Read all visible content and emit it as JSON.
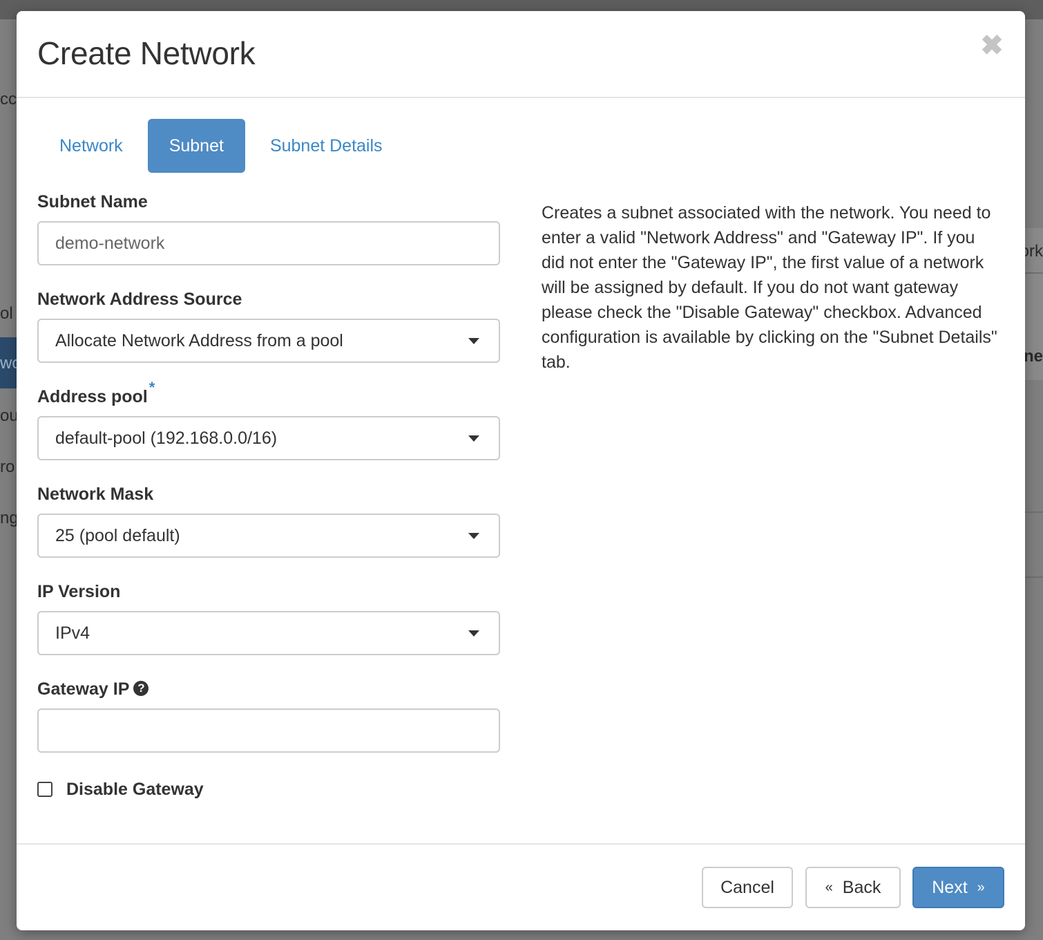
{
  "background": {
    "fragments": [
      "cc",
      "ol",
      "wo",
      "ou",
      "ro",
      "ng",
      "ork",
      "one"
    ]
  },
  "modal": {
    "title": "Create Network",
    "close_icon": "close-icon"
  },
  "tabs": [
    {
      "label": "Network",
      "active": false
    },
    {
      "label": "Subnet",
      "active": true
    },
    {
      "label": "Subnet Details",
      "active": false
    }
  ],
  "form": {
    "subnet_name": {
      "label": "Subnet Name",
      "value": "demo-network"
    },
    "network_address_source": {
      "label": "Network Address Source",
      "selected": "Allocate Network Address from a pool"
    },
    "address_pool": {
      "label": "Address pool",
      "required_marker": "*",
      "selected": "default-pool (192.168.0.0/16)"
    },
    "network_mask": {
      "label": "Network Mask",
      "selected": "25 (pool default)"
    },
    "ip_version": {
      "label": "IP Version",
      "selected": "IPv4"
    },
    "gateway_ip": {
      "label": "Gateway IP",
      "help_icon": "question-circle-icon",
      "value": ""
    },
    "disable_gateway": {
      "label": "Disable Gateway",
      "checked": false
    }
  },
  "description": "Creates a subnet associated with the network. You need to enter a valid \"Network Address\" and \"Gateway IP\". If you did not enter the \"Gateway IP\", the first value of a network will be assigned by default. If you do not want gateway please check the \"Disable Gateway\" checkbox. Advanced configuration is available by clicking on the \"Subnet Details\" tab.",
  "footer": {
    "cancel_label": "Cancel",
    "back_label": "Back",
    "back_chevron": "«",
    "next_label": "Next",
    "next_chevron": "»"
  },
  "colors": {
    "accent": "#4f8bc4",
    "link": "#3a87c8",
    "text": "#333333",
    "border": "#cccccc"
  }
}
